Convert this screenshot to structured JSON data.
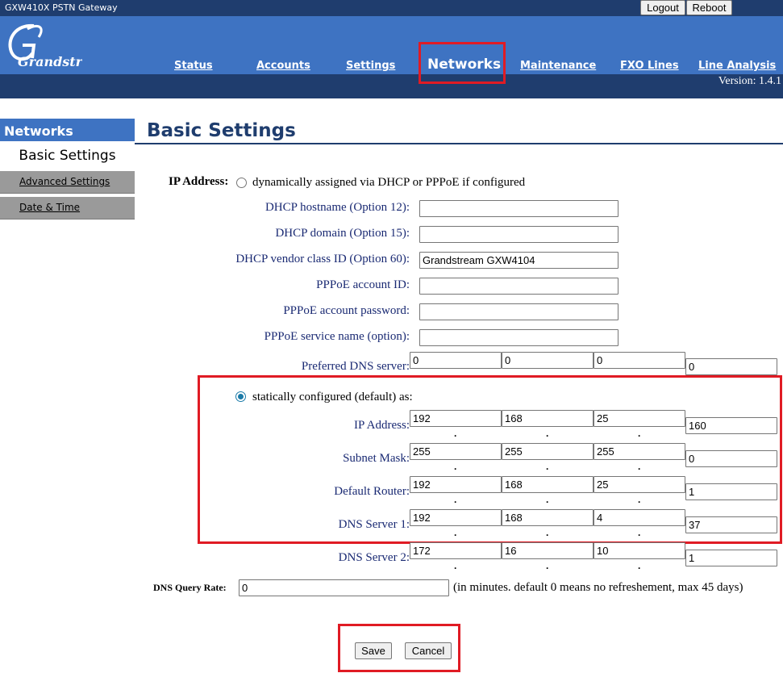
{
  "app": {
    "title": "GXW410X PSTN Gateway",
    "version": "Version: 1.4.1"
  },
  "top_buttons": {
    "logout": "Logout",
    "reboot": "Reboot"
  },
  "logo": {
    "text": "Grandstream",
    "icon": "grandstream-logo"
  },
  "nav": {
    "items": [
      "Status",
      "Accounts",
      "Settings",
      "Networks",
      "Maintenance",
      "FXO Lines",
      "Line Analysis"
    ],
    "active": "Networks"
  },
  "sidebar": {
    "header": "Networks",
    "current": "Basic Settings",
    "items": [
      "Advanced Settings",
      "Date & Time"
    ]
  },
  "page": {
    "title": "Basic Settings"
  },
  "form": {
    "ip_address_label": "IP Address:",
    "dhcp_option": "dynamically assigned via DHCP or PPPoE if configured",
    "dhcp_hostname_label": "DHCP hostname (Option 12):",
    "dhcp_hostname_value": "",
    "dhcp_domain_label": "DHCP domain (Option 15):",
    "dhcp_domain_value": "",
    "dhcp_vendor_label": "DHCP vendor class ID (Option 60):",
    "dhcp_vendor_value": "Grandstream GXW4104",
    "pppoe_id_label": "PPPoE account ID:",
    "pppoe_id_value": "",
    "pppoe_pw_label": "PPPoE account password:",
    "pppoe_pw_value": "",
    "pppoe_service_label": "PPPoE service name (option):",
    "pppoe_service_value": "",
    "preferred_dns_label": "Preferred DNS server:",
    "preferred_dns": [
      "0",
      "0",
      "0",
      "0"
    ],
    "static_option": "statically configured (default) as:",
    "static_selected": true,
    "static_ip_label": "IP Address:",
    "static_ip": [
      "192",
      "168",
      "25",
      "160"
    ],
    "subnet_label": "Subnet Mask:",
    "subnet": [
      "255",
      "255",
      "255",
      "0"
    ],
    "router_label": "Default Router:",
    "router": [
      "192",
      "168",
      "25",
      "1"
    ],
    "dns1_label": "DNS Server 1:",
    "dns1": [
      "192",
      "168",
      "4",
      "37"
    ],
    "dns2_label": "DNS Server 2:",
    "dns2": [
      "172",
      "16",
      "10",
      "1"
    ],
    "dns_rate_label": "DNS Query Rate:",
    "dns_rate_value": "0",
    "dns_rate_note": "(in minutes. default 0 means no refreshement, max 45 days)"
  },
  "actions": {
    "save": "Save",
    "cancel": "Cancel"
  },
  "colors": {
    "header": "#3e73c2",
    "dark": "#1f3d6e",
    "highlight": "#e01b24"
  }
}
